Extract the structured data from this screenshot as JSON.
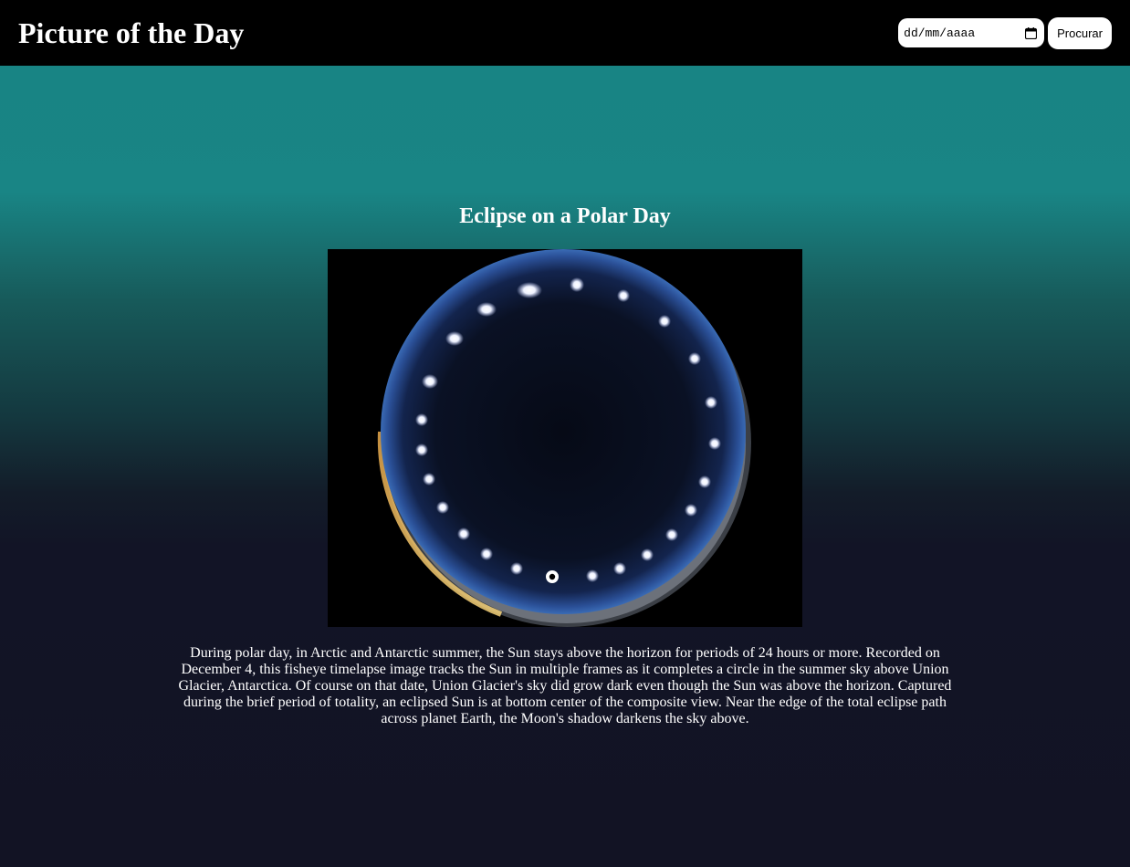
{
  "header": {
    "title": "Picture of the Day",
    "date_input": {
      "placeholder": "dd/mm/aaaa"
    },
    "search_label": "Procurar"
  },
  "apod": {
    "title": "Eclipse on a Polar Day",
    "description": "During polar day, in Arctic and Antarctic summer, the Sun stays above the horizon for periods of 24 hours or more. Recorded on December 4, this fisheye timelapse image tracks the Sun in multiple frames as it completes a circle in the summer sky above Union Glacier, Antarctica. Of course on that date, Union Glacier's sky did grow dark even though the Sun was above the horizon. Captured during the brief period of totality, an eclipsed Sun is at bottom center of the composite view. Near the edge of the total eclipse path across planet Earth, the Moon's shadow darkens the sky above."
  },
  "icons": {
    "date_picker": "calendar-icon"
  },
  "colors": {
    "header_bg": "#000000",
    "gradient_top": "#188383",
    "gradient_bottom": "#121324",
    "text": "#ffffff"
  }
}
